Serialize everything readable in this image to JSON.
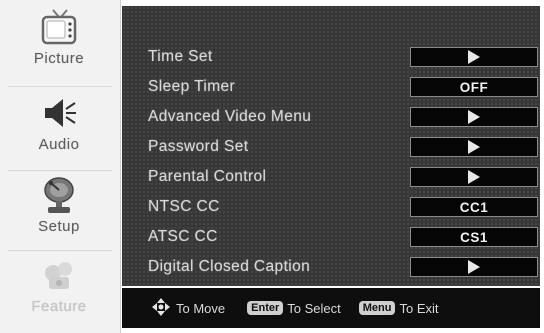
{
  "sidebar": {
    "items": [
      {
        "label": "Picture",
        "icon": "tv-icon"
      },
      {
        "label": "Audio",
        "icon": "speaker-icon"
      },
      {
        "label": "Setup",
        "icon": "satellite-dish-icon"
      },
      {
        "label": "Feature",
        "icon": "feature-icon"
      }
    ]
  },
  "menu": {
    "rows": [
      {
        "label": "Time Set",
        "value": "",
        "has_arrow": true
      },
      {
        "label": "Sleep Timer",
        "value": "OFF",
        "has_arrow": false
      },
      {
        "label": "Advanced Video Menu",
        "value": "",
        "has_arrow": true
      },
      {
        "label": "Password Set",
        "value": "",
        "has_arrow": true
      },
      {
        "label": "Parental Control",
        "value": "",
        "has_arrow": true
      },
      {
        "label": "NTSC CC",
        "value": "CC1",
        "has_arrow": false
      },
      {
        "label": "ATSC CC",
        "value": "CS1",
        "has_arrow": false
      },
      {
        "label": "Digital Closed Caption",
        "value": "",
        "has_arrow": true
      }
    ]
  },
  "footer": {
    "move_text": "To Move",
    "enter_key": "Enter",
    "select_text": "To Select",
    "menu_key": "Menu",
    "exit_text": "To Exit"
  },
  "colors": {
    "panel_bg": "#373737",
    "footer_bg": "#0e0e0e",
    "value_box_bg": "#050505"
  }
}
